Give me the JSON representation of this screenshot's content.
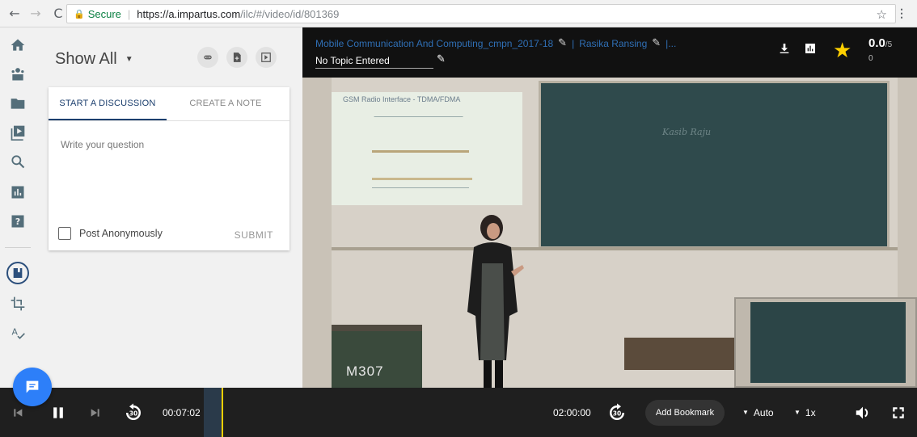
{
  "browser": {
    "secure_label": "Secure",
    "url_host": "https://a.impartus.com",
    "url_path": "/ilc/#/video/id/801369"
  },
  "sidebar": {
    "icons": [
      "home-icon",
      "classroom-icon",
      "folder-icon",
      "video-library-icon",
      "search-icon",
      "analytics-icon",
      "help-icon",
      "notes-icon",
      "crop-icon",
      "spellcheck-icon"
    ]
  },
  "panel": {
    "filter_label": "Show All",
    "tabs": [
      {
        "label": "START A DISCUSSION",
        "active": true
      },
      {
        "label": "CREATE A NOTE",
        "active": false
      }
    ],
    "question_placeholder": "Write your question",
    "anonymous_label": "Post Anonymously",
    "submit_label": "SUBMIT"
  },
  "video": {
    "title": "Mobile Communication And Computing_cmpn_2017-18",
    "separator": "|",
    "instructor": "Rasika Ransing",
    "more": "|...",
    "topic": "No Topic Entered",
    "rating": "0.0",
    "rating_max": "/5",
    "rating_count": "0",
    "slide_title": "GSM Radio Interface - TDMA/FDMA",
    "board_text": "Kasib Raju",
    "room_label": "M307"
  },
  "controls": {
    "current_time": "00:07:02",
    "total_time": "02:00:00",
    "bookmark_label": "Add Bookmark",
    "quality": "Auto",
    "speed": "1x",
    "skip_back_label": "30",
    "skip_forward_label": "30",
    "progress_fraction": 0.0586,
    "accent_color": "#ffd000"
  }
}
